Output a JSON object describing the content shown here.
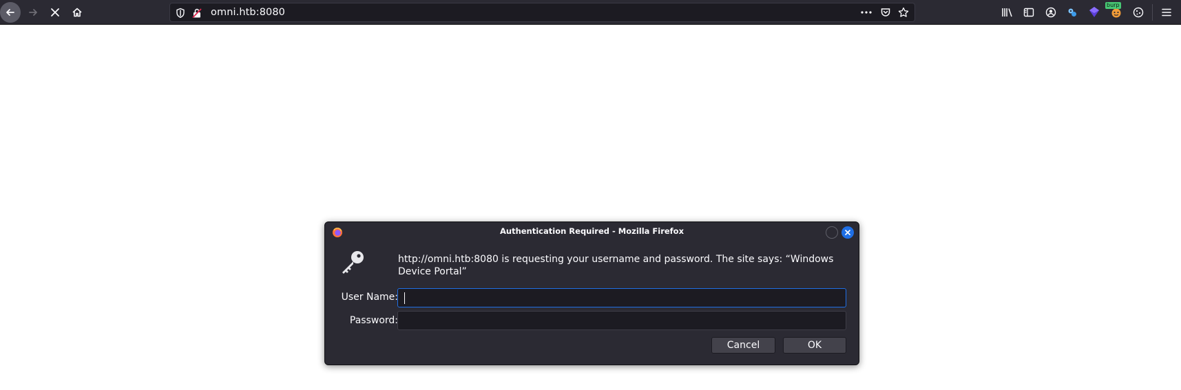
{
  "browser": {
    "url": "omni.htb:8080",
    "toolbar_icons": [
      "back-icon",
      "forward-icon",
      "stop-icon",
      "home-icon",
      "shield-icon",
      "insecure-lock-icon",
      "page-actions-icon",
      "pocket-icon",
      "bookmark-star-icon",
      "library-icon",
      "sidebar-icon",
      "account-icon",
      "extension-icon",
      "extension-icon",
      "burp-icon",
      "cookie-icon",
      "menu-icon"
    ],
    "burp_badge": "burp"
  },
  "dialog": {
    "title": "Authentication Required - Mozilla Firefox",
    "message": "http://omni.htb:8080 is requesting your username and password. The site says: “Windows Device Portal”",
    "user_label": "User Name:",
    "password_label": "Password:",
    "user_value": "",
    "password_value": "",
    "cancel_label": "Cancel",
    "ok_label": "OK"
  },
  "colors": {
    "toolbar": "#2b2a33",
    "urlbar": "#1c1b22",
    "accent": "#1f6fe5",
    "text": "#fbfbfe"
  }
}
